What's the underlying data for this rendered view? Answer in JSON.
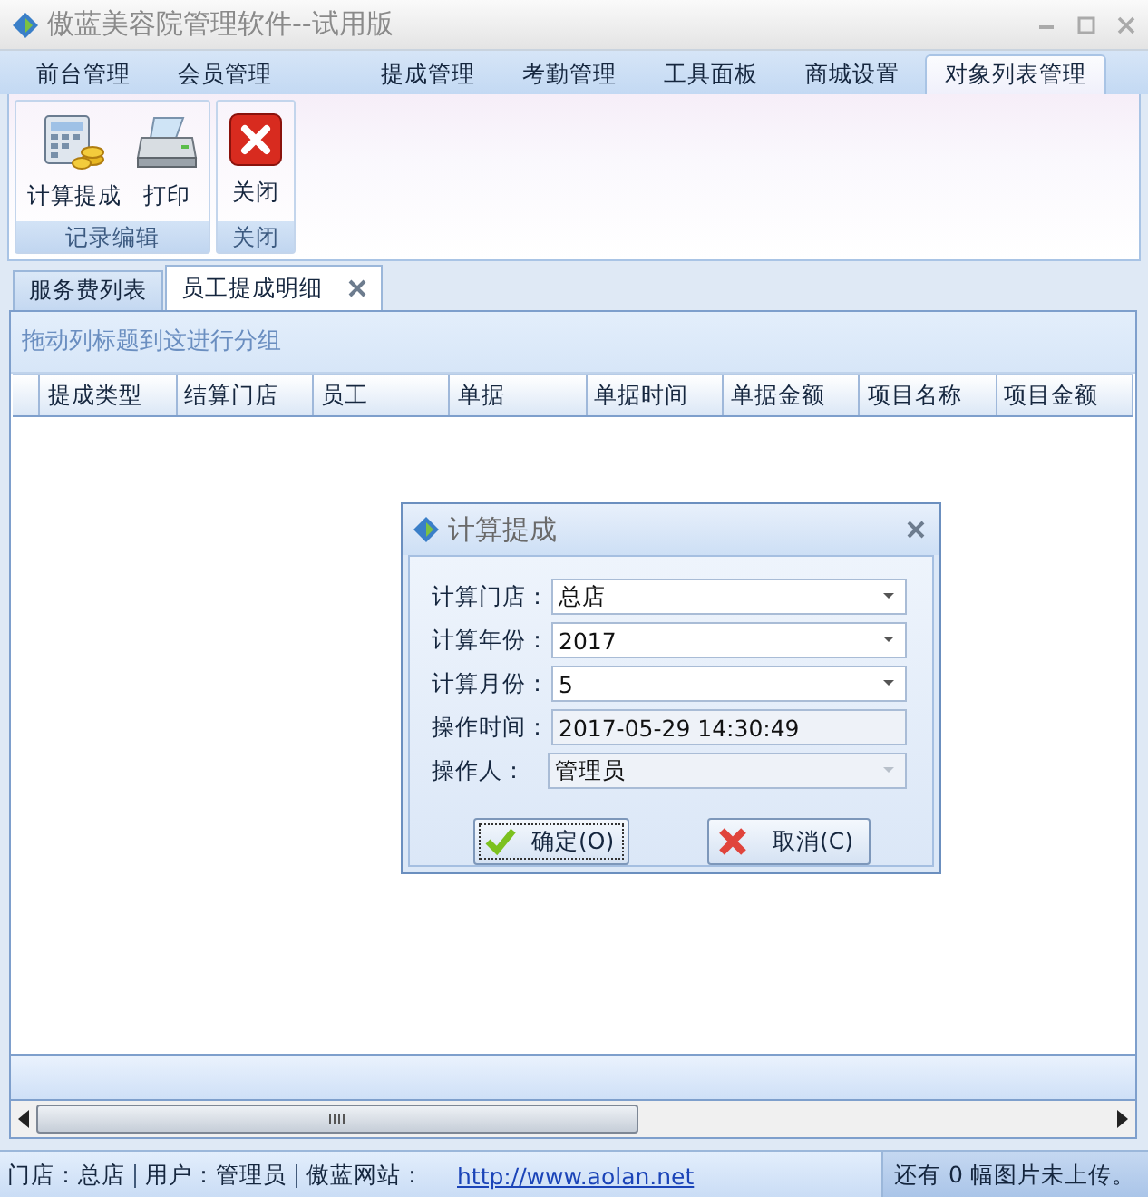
{
  "window": {
    "title": "傲蓝美容院管理软件--试用版"
  },
  "menu_tabs": [
    {
      "label": "前台管理",
      "selected": false
    },
    {
      "label": "会员管理",
      "selected": false
    },
    {
      "label": "提成管理",
      "selected": false
    },
    {
      "label": "考勤管理",
      "selected": false
    },
    {
      "label": "工具面板",
      "selected": false
    },
    {
      "label": "商城设置",
      "selected": false
    },
    {
      "label": "对象列表管理",
      "selected": true
    }
  ],
  "ribbon": {
    "groups": [
      {
        "label": "记录编辑",
        "buttons": [
          {
            "label": "计算提成",
            "kind": "calculator"
          },
          {
            "label": "打印",
            "kind": "printer"
          }
        ]
      },
      {
        "label": "关闭",
        "buttons": [
          {
            "label": "关闭",
            "kind": "close"
          }
        ]
      }
    ]
  },
  "doc_tabs": [
    {
      "label": "服务费列表",
      "selected": false,
      "closable": false
    },
    {
      "label": "员工提成明细",
      "selected": true,
      "closable": true
    }
  ],
  "grid": {
    "group_hint": "拖动列标题到这进行分组",
    "columns": [
      "提成类型",
      "结算门店",
      "员工",
      "单据",
      "单据时间",
      "单据金额",
      "项目名称",
      "项目金额"
    ]
  },
  "dialog": {
    "title": "计算提成",
    "fields": [
      {
        "label": "计算门店：",
        "value": "总店",
        "kind": "combo",
        "disabled": false
      },
      {
        "label": "计算年份：",
        "value": "2017",
        "kind": "combo",
        "disabled": false
      },
      {
        "label": "计算月份：",
        "value": "5",
        "kind": "combo",
        "disabled": false
      },
      {
        "label": "操作时间：",
        "value": "2017-05-29 14:30:49",
        "kind": "text",
        "disabled": true
      },
      {
        "label": "操作人：",
        "value": "管理员",
        "kind": "combo",
        "disabled": true
      }
    ],
    "buttons": [
      {
        "label": "确定(O)",
        "kind": "ok",
        "focused": true
      },
      {
        "label": "取消(C)",
        "kind": "cancel",
        "focused": false
      }
    ]
  },
  "status_bar": {
    "items": [
      "门店：总店",
      "用户：管理员",
      "傲蓝网站："
    ],
    "link": "http://www.aolan.net",
    "upload_note": "还有 0 幅图片未上传。"
  }
}
